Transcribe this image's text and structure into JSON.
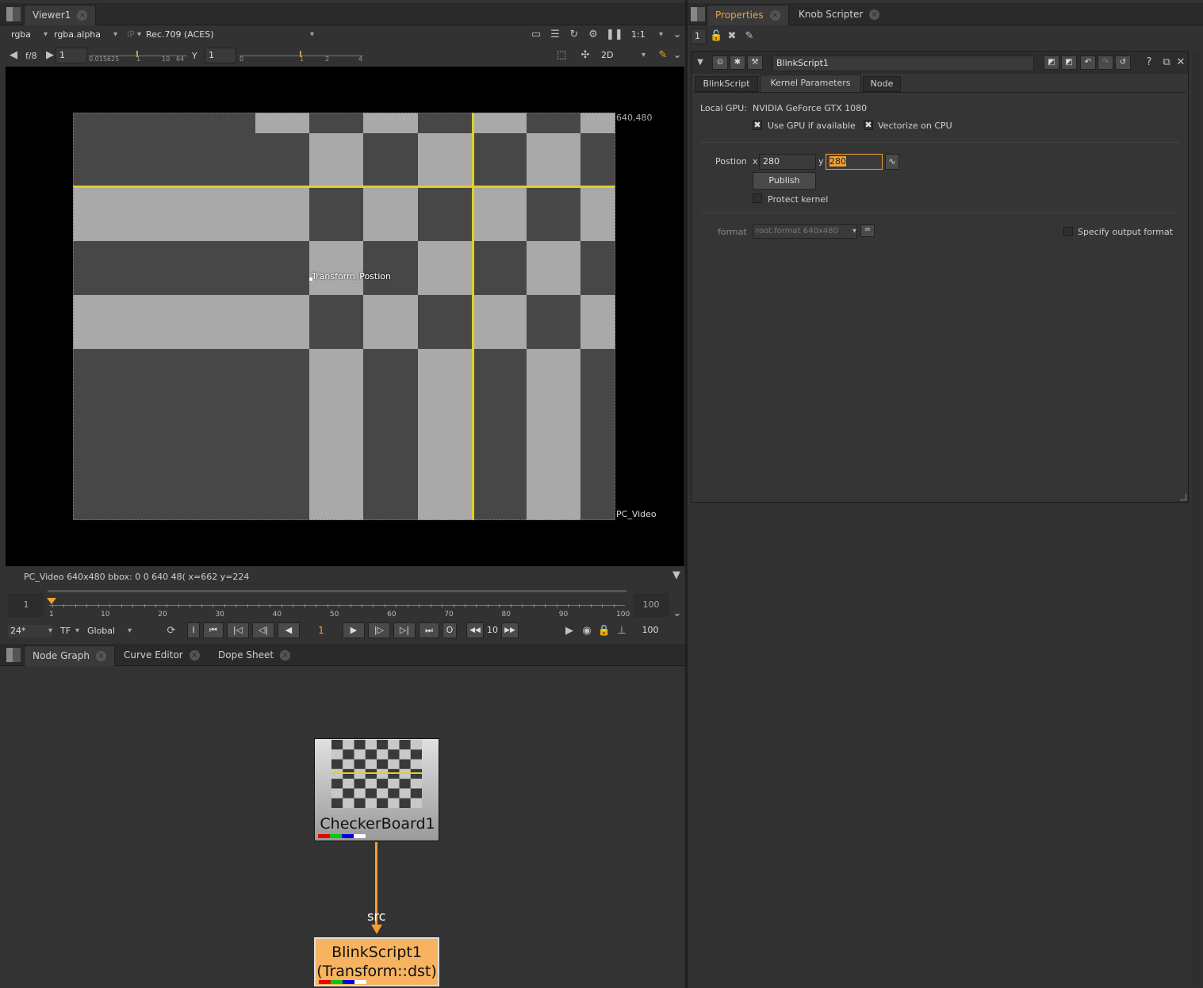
{
  "viewer": {
    "tab_label": "Viewer1",
    "channels": "rgba",
    "alpha_channel": "rgba.alpha",
    "ip_label": "IP",
    "colorspace": "Rec.709 (ACES)",
    "zoom": "1:1",
    "fstop": "f/8",
    "gain_value": "1",
    "gain_ticks": [
      "0.015625",
      "1",
      "10",
      "64"
    ],
    "gamma_label": "Y",
    "gamma_value": "1",
    "gamma_ticks": [
      "0",
      "1",
      "2",
      "4"
    ],
    "view_mode": "2D",
    "format_corner": "640,480",
    "format_name": "PC_Video",
    "overlay_label": "Transform_Postion",
    "status": "PC_Video 640x480  bbox: 0 0 640 48(  x=662 y=224"
  },
  "timeline": {
    "start_frame": "1",
    "end_frame": "100",
    "current_frame": "1",
    "ticks": [
      "1",
      "10",
      "20",
      "30",
      "40",
      "50",
      "60",
      "70",
      "80",
      "90",
      "100"
    ],
    "fps": "24*",
    "tf": "TF",
    "range_mode": "Global",
    "in_label": "I",
    "out_label": "O",
    "skip": "10",
    "end_value": "100"
  },
  "bottom_tabs": [
    {
      "label": "Node Graph"
    },
    {
      "label": "Curve Editor"
    },
    {
      "label": "Dope Sheet"
    }
  ],
  "nodes": {
    "checker": {
      "label": "CheckerBoard1"
    },
    "blink": {
      "label_line1": "BlinkScript1",
      "label_line2": "(Transform::dst)"
    },
    "edge_label": "src"
  },
  "properties": {
    "tab_label": "Properties",
    "scripter_tab": "Knob Scripter",
    "max_panels": "1",
    "node_name": "BlinkScript1",
    "subtabs": [
      {
        "label": "BlinkScript"
      },
      {
        "label": "Kernel Parameters"
      },
      {
        "label": "Node"
      }
    ],
    "local_gpu_label": "Local GPU:",
    "local_gpu_value": "NVIDIA GeForce GTX 1080",
    "use_gpu": "Use GPU if available",
    "vectorize": "Vectorize on CPU",
    "position_label": "Postion",
    "x_label": "x",
    "x_value": "280",
    "y_label": "y",
    "y_value": "280",
    "publish": "Publish",
    "protect": "Protect kernel",
    "format_label": "format",
    "format_value": "root.format 640x480",
    "specify_format": "Specify output format"
  },
  "colors": {
    "accent": "#f0a030",
    "node_blink": "#f7b360",
    "guide": "#e0d020",
    "dark_check": "#474747",
    "light_check": "#a9a9a9"
  }
}
